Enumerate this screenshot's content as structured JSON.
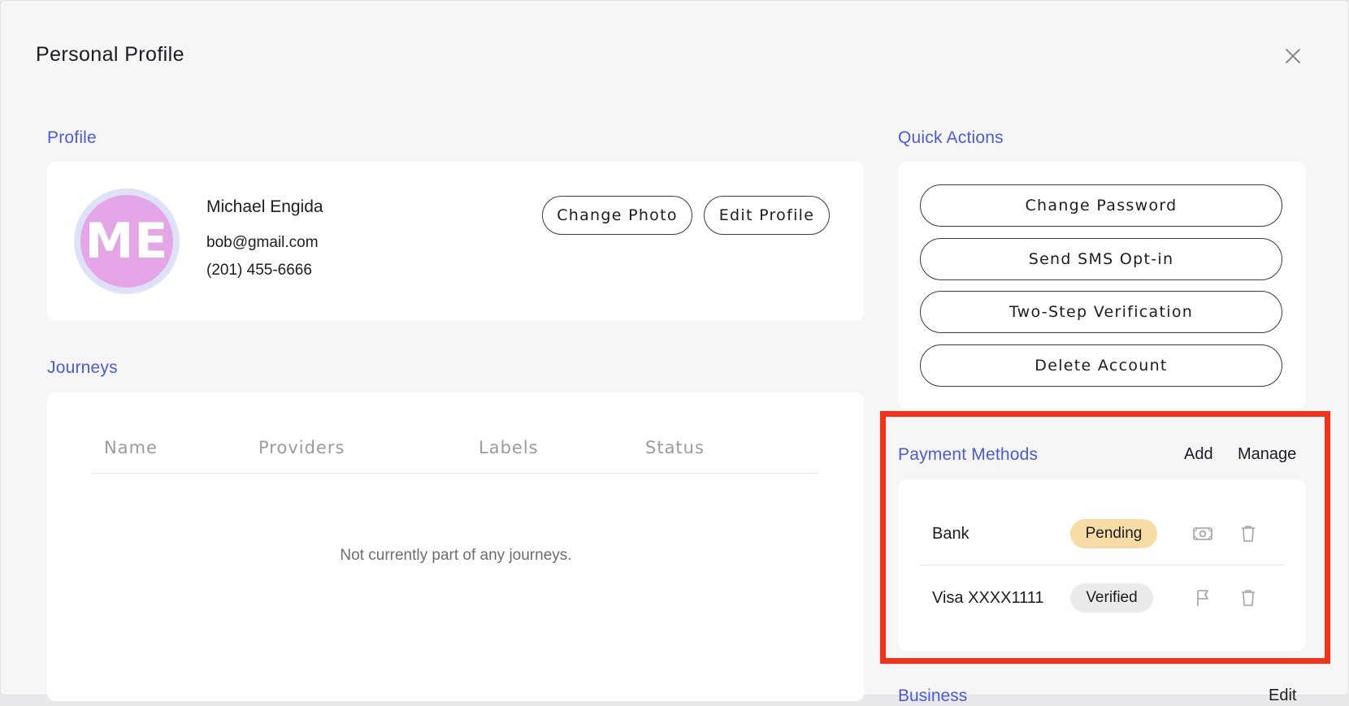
{
  "modal": {
    "title": "Personal Profile",
    "close_icon": "close-icon"
  },
  "profile": {
    "section_title": "Profile",
    "avatar_initials": "ME",
    "name": "Michael Engida",
    "email": "bob@gmail.com",
    "phone": "(201) 455-6666",
    "change_photo_label": "Change Photo",
    "edit_profile_label": "Edit Profile"
  },
  "journeys": {
    "section_title": "Journeys",
    "columns": [
      "Name",
      "Providers",
      "Labels",
      "Status"
    ],
    "empty_message": "Not currently part of any journeys."
  },
  "quick_actions": {
    "section_title": "Quick Actions",
    "buttons": [
      "Change Password",
      "Send SMS Opt-in",
      "Two-Step Verification",
      "Delete Account"
    ]
  },
  "payment_methods": {
    "section_title": "Payment Methods",
    "add_label": "Add",
    "manage_label": "Manage",
    "items": [
      {
        "label": "Bank",
        "status": "Pending",
        "status_color": "#f8dca6",
        "action_icon": "money-icon",
        "delete_icon": "trash-icon"
      },
      {
        "label": "Visa XXXX1111",
        "status": "Verified",
        "status_color": "#ebebed",
        "action_icon": "flag-icon",
        "delete_icon": "trash-icon"
      }
    ]
  },
  "business": {
    "section_title": "Business",
    "edit_label": "Edit"
  },
  "colors": {
    "accent": "#4c5bd6",
    "highlight_border": "#f1311a",
    "avatar_bg": "#e5a6e8",
    "avatar_ring": "#dfe1f8"
  }
}
